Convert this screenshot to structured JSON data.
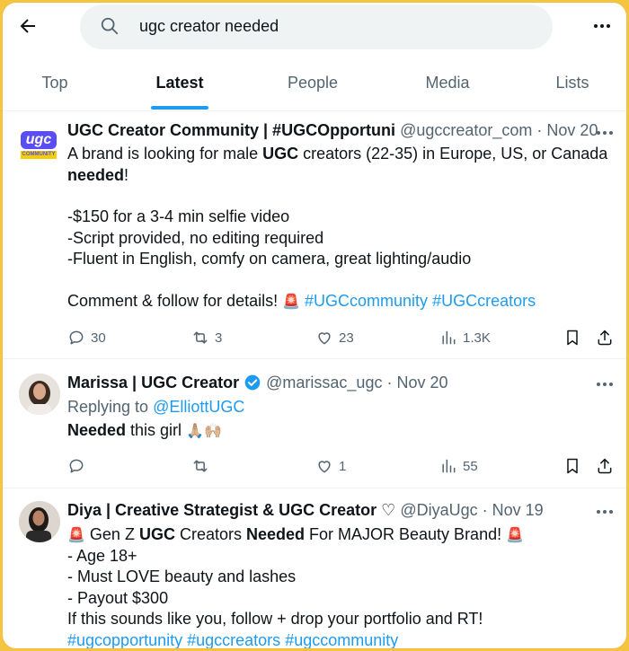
{
  "search": {
    "query": "ugc creator needed"
  },
  "tabs": [
    {
      "label": "Top"
    },
    {
      "label": "Latest"
    },
    {
      "label": "People"
    },
    {
      "label": "Media"
    },
    {
      "label": "Lists"
    }
  ],
  "tweets": [
    {
      "name": "UGC Creator Community | #UGCOpportuni",
      "handle": "@ugccreator_com",
      "date": "· Nov 20",
      "avatar_text": "ugc",
      "avatar_sub": "COMMUNITY",
      "text": {
        "l1a": "A brand is looking for male ",
        "l1b": "UGC",
        "l1c": " creators (22-35) in Europe, US, or Canada",
        "l2a": "needed",
        "l2b": "!",
        "l3": "-$150 for a 3-4 min selfie video",
        "l4": "-Script provided, no editing required",
        "l5": "-Fluent in English, comfy on camera, great lighting/audio",
        "l6a": "Comment & follow for details! ",
        "l6emoji": "🚨",
        "l6b": "#UGCcommunity",
        "l6c": "#UGCcreators"
      },
      "replies": "30",
      "retweets": "3",
      "likes": "23",
      "views": "1.3K"
    },
    {
      "name": "Marissa | UGC Creator",
      "handle": "@marissac_ugc",
      "date": "· Nov 20",
      "replying_prefix": "Replying to ",
      "replying_to": "@ElliottUGC",
      "text": {
        "a": "Needed",
        "b": " this girl ",
        "emoji": "🙏🏼🙌🏼"
      },
      "replies": "",
      "retweets": "",
      "likes": "1",
      "views": "55"
    },
    {
      "name": "Diya | Creative Strategist & UGC Creator",
      "name_suffix": "♡",
      "handle": "@DiyaUgc",
      "date": "· Nov 19",
      "text": {
        "emoji": "🚨",
        "l1a": " Gen Z ",
        "l1b": "UGC",
        "l1c": " Creators ",
        "l1d": "Needed",
        "l1e": " For MAJOR Beauty Brand! ",
        "l2": "- Age 18+",
        "l3": "- Must LOVE beauty and lashes",
        "l4": "- Payout $300",
        "l5": "If this sounds like you, follow + drop your portfolio and RT!",
        "h1": "#ugcopportunity",
        "h2": "#ugccreators",
        "h3": "#ugccommunity"
      }
    }
  ],
  "colors": {
    "accent": "#1d9bf0",
    "text": "#0f1419",
    "muted": "#536471",
    "frame": "#f5c542"
  }
}
